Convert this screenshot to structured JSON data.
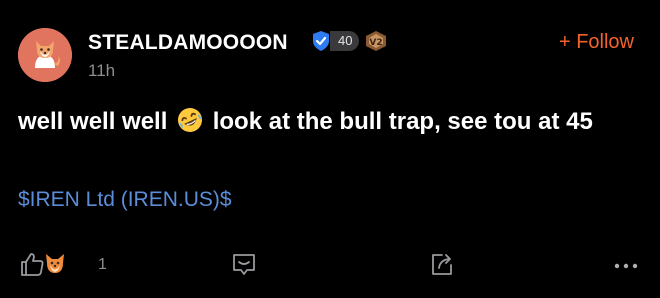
{
  "colors": {
    "background": "#000000",
    "accent_follow": "#f2622e",
    "link_blue": "#5b8dd9",
    "muted_text": "#8e8e93",
    "avatar_bg": "#e0745f",
    "shield_blue": "#2f7bf2"
  },
  "author": {
    "name": "STEALDAMOOOON",
    "level": "40",
    "timestamp": "11h",
    "avatar_icon": "shiba-dog-avatar-icon",
    "badges": [
      "shield-check-icon",
      "v2-badge-icon"
    ]
  },
  "follow": {
    "label": "+ Follow"
  },
  "post": {
    "text_before_emoji": "well well well ",
    "emoji": "rolling-on-floor-laughing-emoji",
    "text_after_emoji": " look at the bull trap, see tou at 45",
    "ticker": "$IREN Ltd (IREN.US)$"
  },
  "actions": {
    "like_count": "1",
    "icons": [
      "thumbs-up-icon",
      "dog-reaction-icon",
      "comment-icon",
      "share-icon",
      "more-icon"
    ]
  }
}
